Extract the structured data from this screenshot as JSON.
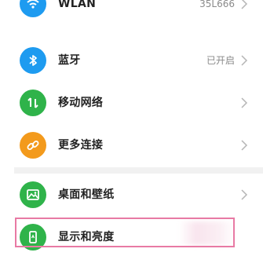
{
  "settings": {
    "items": [
      {
        "label": "WLAN",
        "value": "35L666",
        "icon": "wifi-icon",
        "color": "#1e9bf0"
      },
      {
        "label": "蓝牙",
        "value": "已开启",
        "icon": "bluetooth-icon",
        "color": "#1e9bf0"
      },
      {
        "label": "移动网络",
        "value": "",
        "icon": "mobile-data-icon",
        "color": "#2fb34a"
      },
      {
        "label": "更多连接",
        "value": "",
        "icon": "link-icon",
        "color": "#f39a1c"
      },
      {
        "label": "桌面和壁纸",
        "value": "",
        "icon": "wallpaper-icon",
        "color": "#2fb34a"
      },
      {
        "label": "显示和亮度",
        "value": "",
        "icon": "display-icon",
        "color": "#2fb34a"
      }
    ]
  },
  "colors": {
    "accent_blue": "#1e9bf0",
    "accent_green": "#2fb34a",
    "accent_orange": "#f39a1c",
    "highlight_border": "#e87aa4"
  }
}
